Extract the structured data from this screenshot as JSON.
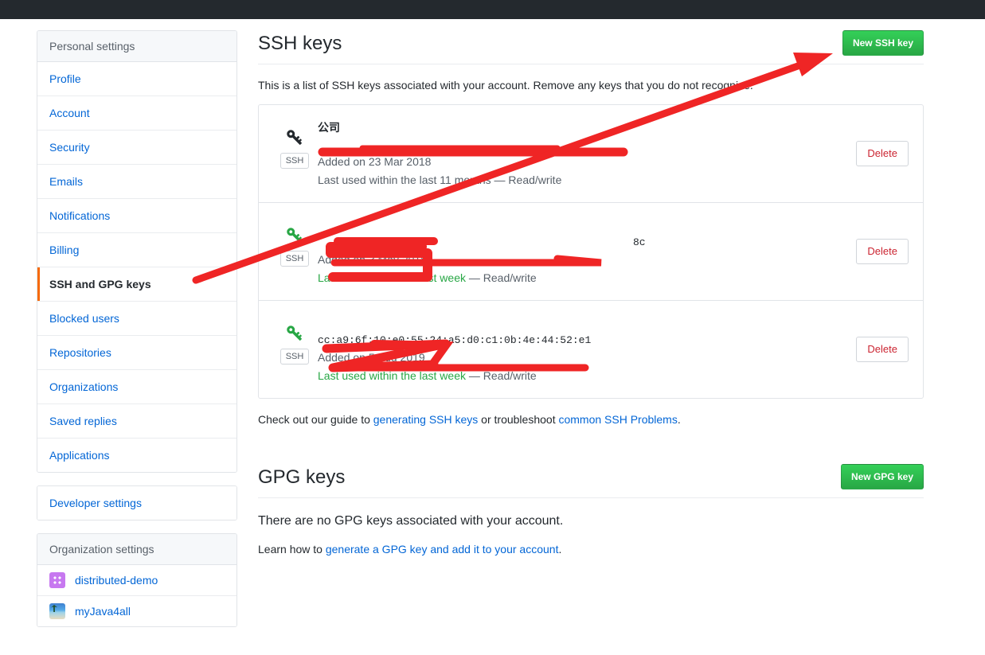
{
  "window": {
    "top_bar_color": "#24292e"
  },
  "sidebar": {
    "personal": {
      "header": "Personal settings",
      "items": [
        {
          "label": "Profile",
          "selected": false
        },
        {
          "label": "Account",
          "selected": false
        },
        {
          "label": "Security",
          "selected": false
        },
        {
          "label": "Emails",
          "selected": false
        },
        {
          "label": "Notifications",
          "selected": false
        },
        {
          "label": "Billing",
          "selected": false
        },
        {
          "label": "SSH and GPG keys",
          "selected": true
        },
        {
          "label": "Blocked users",
          "selected": false
        },
        {
          "label": "Repositories",
          "selected": false
        },
        {
          "label": "Organizations",
          "selected": false
        },
        {
          "label": "Saved replies",
          "selected": false
        },
        {
          "label": "Applications",
          "selected": false
        }
      ]
    },
    "developer": {
      "label": "Developer settings"
    },
    "organization": {
      "header": "Organization settings",
      "items": [
        {
          "label": "distributed-demo",
          "avatar": "purple-building-icon"
        },
        {
          "label": "myJava4all",
          "avatar": "beach-photo-icon"
        }
      ]
    },
    "active_indicator_color": "#f66a0a"
  },
  "ssh": {
    "title": "SSH keys",
    "new_key_button": "New SSH key",
    "intro": "This is a list of SSH keys associated with your account. Remove any keys that you do not recognize.",
    "delete_button": "Delete",
    "badge": "SSH",
    "keys": [
      {
        "name": "公司",
        "name_redacted": false,
        "fingerprint": "",
        "fingerprint_redacted": true,
        "added": "Added on 23 Mar 2018",
        "last_used": "Last used within the last 11 months",
        "access": " — Read/write",
        "state": "stale",
        "icon": "key-icon-dark"
      },
      {
        "name": "",
        "name_redacted": true,
        "fingerprint": "",
        "fingerprint_redacted": true,
        "fingerprint_tail": "8c",
        "added": "Added on 3 May 2018",
        "last_used": "Last used within the last week",
        "access": " — Read/write",
        "state": "fresh",
        "icon": "key-icon-green"
      },
      {
        "name": "",
        "name_redacted": true,
        "fingerprint": "cc:a9:6f:10:e0:55:24:a5:d0:c1:0b:4e:44:5",
        "fingerprint_redacted": true,
        "fingerprint_tail": "2:e1",
        "added": "Added on 5 Aug 2019",
        "last_used": "Last used within the last week",
        "access": " — Read/write",
        "state": "fresh",
        "icon": "key-icon-green"
      }
    ],
    "help_prefix": "Check out our guide to ",
    "help_link1": "generating SSH keys",
    "help_middle": " or troubleshoot ",
    "help_link2": "common SSH Problems",
    "help_suffix": "."
  },
  "gpg": {
    "title": "GPG keys",
    "new_key_button": "New GPG key",
    "empty_message": "There are no GPG keys associated with your account.",
    "learn_prefix": "Learn how to ",
    "learn_link": "generate a GPG key and add it to your account",
    "learn_suffix": "."
  },
  "annotations": {
    "color": "#ef2525",
    "arrow_target": "New SSH key button",
    "redaction_count": 5
  },
  "colors": {
    "link": "#0366d6",
    "green_button": "#28a745",
    "delete_text": "#cb2431",
    "fresh_green": "#28a745",
    "muted": "#586069",
    "annotation_red": "#ef2525"
  }
}
